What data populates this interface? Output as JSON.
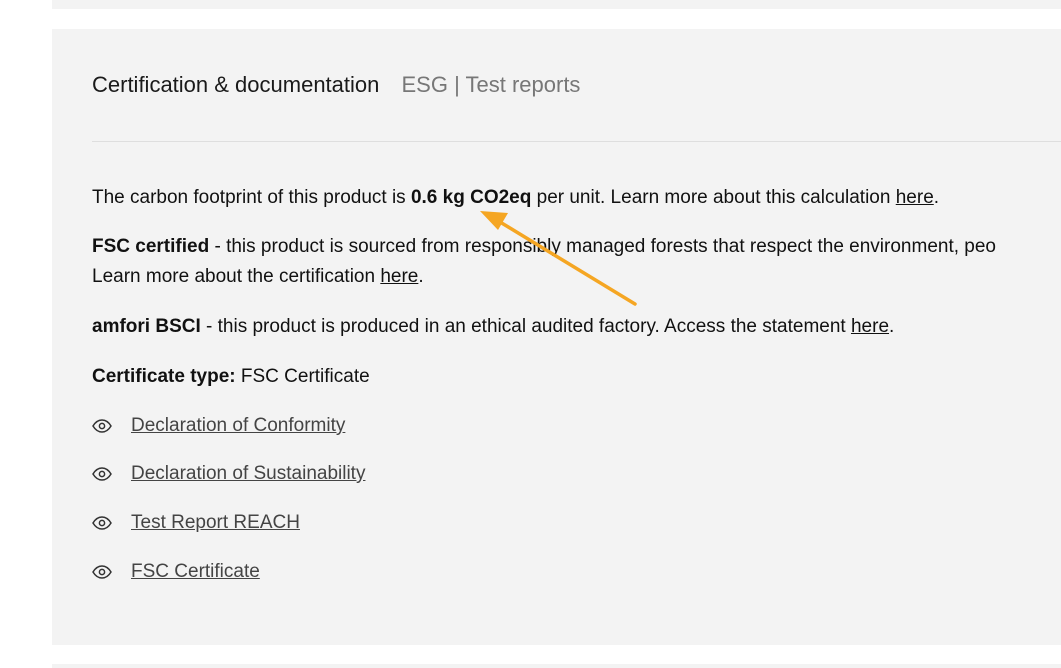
{
  "tabs": [
    {
      "label": "Certification & documentation",
      "active": true
    },
    {
      "label": "ESG | Test reports",
      "active": false
    }
  ],
  "carbon": {
    "prefix": "The carbon footprint of this product is ",
    "value": "0.6 kg CO2eq",
    "suffix": " per unit. Learn more about this calculation ",
    "link": "here",
    "end": "."
  },
  "fsc": {
    "title": "FSC certified",
    "line1": " - this product is sourced from responsibly managed forests that respect the environment, peo",
    "line2": "Learn more about the certification ",
    "link": "here",
    "end": "."
  },
  "amfori": {
    "title": "amfori BSCI",
    "text": " - this product is produced in an ethical audited factory. Access the statement ",
    "link": "here",
    "end": "."
  },
  "certificate": {
    "label": "Certificate type:",
    "value": " FSC Certificate"
  },
  "documents": [
    {
      "label": "Declaration of Conformity",
      "icon": "eye-icon"
    },
    {
      "label": "Declaration of Sustainability",
      "icon": "eye-icon"
    },
    {
      "label": "Test Report REACH",
      "icon": "eye-icon"
    },
    {
      "label": "FSC Certificate",
      "icon": "eye-icon"
    }
  ],
  "colors": {
    "panel": "#f3f3f3",
    "annotation_arrow": "#f5a623"
  }
}
